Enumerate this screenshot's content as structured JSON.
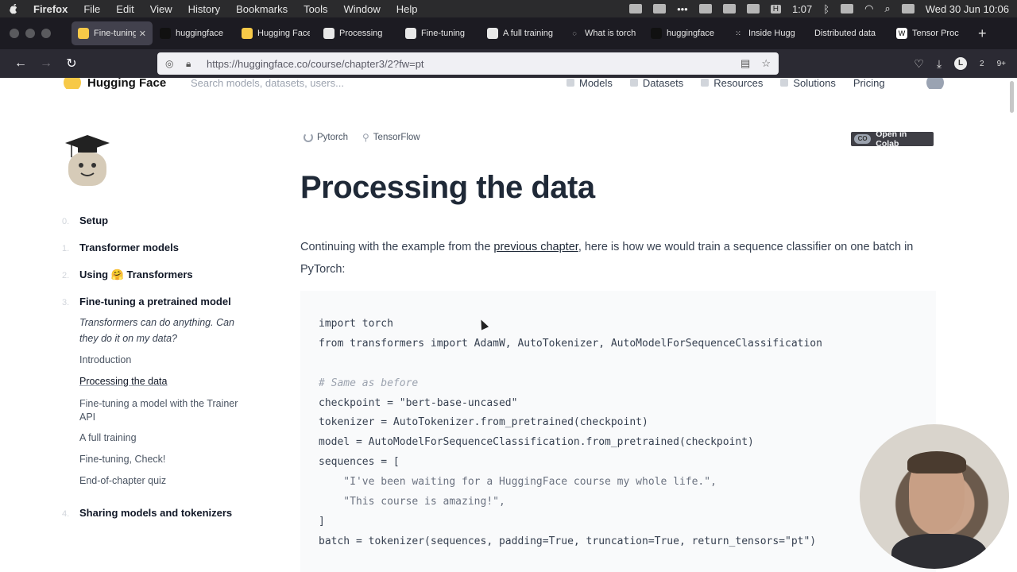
{
  "menubar": {
    "app": "Firefox",
    "items": [
      "File",
      "Edit",
      "View",
      "History",
      "Bookmarks",
      "Tools",
      "Window",
      "Help"
    ],
    "time_pill": "1:07",
    "h_badge": "H",
    "datetime": "Wed 30 Jun  10:06"
  },
  "tabs": [
    {
      "label": "Fine-tuning",
      "icon": "hf-icon",
      "active": true
    },
    {
      "label": "huggingface",
      "icon": "github-icon"
    },
    {
      "label": "Hugging Face",
      "icon": "hf-icon"
    },
    {
      "label": "Processing",
      "icon": "colab-icon"
    },
    {
      "label": "Fine-tuning",
      "icon": "colab-icon"
    },
    {
      "label": "A full training",
      "icon": "colab-icon"
    },
    {
      "label": "What is torch",
      "icon": "loading-icon"
    },
    {
      "label": "huggingface",
      "icon": "github-icon"
    },
    {
      "label": "Inside Hugg",
      "icon": "grid-icon"
    },
    {
      "label": "Distributed data",
      "icon": "none"
    },
    {
      "label": "Tensor Proc",
      "icon": "wikipedia-icon"
    }
  ],
  "navbar": {
    "url": "https://huggingface.co/course/chapter3/2?fw=pt",
    "downloads_badge": "2",
    "extensions_badge": "9+",
    "account_initial": "L"
  },
  "hf_header": {
    "brand": "Hugging Face",
    "search_placeholder": "Search models, datasets, users...",
    "nav": [
      "Models",
      "Datasets",
      "Resources",
      "Solutions",
      "Pricing"
    ]
  },
  "framework": {
    "pytorch": "Pytorch",
    "tensorflow": "TensorFlow",
    "colab": "Open in Colab",
    "colab_icon_text": "CO"
  },
  "sidebar": {
    "chapters": [
      {
        "num": "0.",
        "label": "Setup"
      },
      {
        "num": "1.",
        "label": "Transformer models"
      },
      {
        "num": "2.",
        "label": "Using 🤗 Transformers"
      },
      {
        "num": "3.",
        "label": "Fine-tuning a pretrained model"
      },
      {
        "num": "4.",
        "label": "Sharing models and tokenizers"
      }
    ],
    "chapter3_intro": "Transformers can do anything. Can they do it on my data?",
    "chapter3_sections": [
      {
        "label": "Introduction"
      },
      {
        "label": "Processing the data",
        "active": true
      },
      {
        "label": "Fine-tuning a model with the Trainer API"
      },
      {
        "label": "A full training"
      },
      {
        "label": "Fine-tuning, Check!"
      },
      {
        "label": "End-of-chapter quiz"
      }
    ]
  },
  "main": {
    "title": "Processing the data",
    "intro_before": "Continuing with the example from the ",
    "intro_link": "previous chapter",
    "intro_after": ", here is how we would train a sequence classifier on one batch in PyTorch:",
    "code_lines": [
      {
        "text": "import torch",
        "kind": "code"
      },
      {
        "text": "from transformers import AdamW, AutoTokenizer, AutoModelForSequenceClassification",
        "kind": "code"
      },
      {
        "text": "",
        "kind": "blank"
      },
      {
        "text": "# Same as before",
        "kind": "comment"
      },
      {
        "text": "checkpoint = \"bert-base-uncased\"",
        "kind": "code"
      },
      {
        "text": "tokenizer = AutoTokenizer.from_pretrained(checkpoint)",
        "kind": "code"
      },
      {
        "text": "model = AutoModelForSequenceClassification.from_pretrained(checkpoint)",
        "kind": "code"
      },
      {
        "text": "sequences = [",
        "kind": "code"
      },
      {
        "text": "    \"I've been waiting for a HuggingFace course my whole life.\",",
        "kind": "string"
      },
      {
        "text": "    \"This course is amazing!\",",
        "kind": "string"
      },
      {
        "text": "]",
        "kind": "code"
      },
      {
        "text": "batch = tokenizer(sequences, padding=True, truncation=True, return_tensors=\"pt\")",
        "kind": "code"
      }
    ]
  },
  "colors": {
    "menubar_bg": "#2b2b2d",
    "tabstrip_bg": "#1c1b22",
    "active_tab_bg": "#42414d",
    "navbar_bg": "#2b2a33",
    "code_bg": "#f9fafb",
    "hf_yellow": "#f7c948"
  }
}
